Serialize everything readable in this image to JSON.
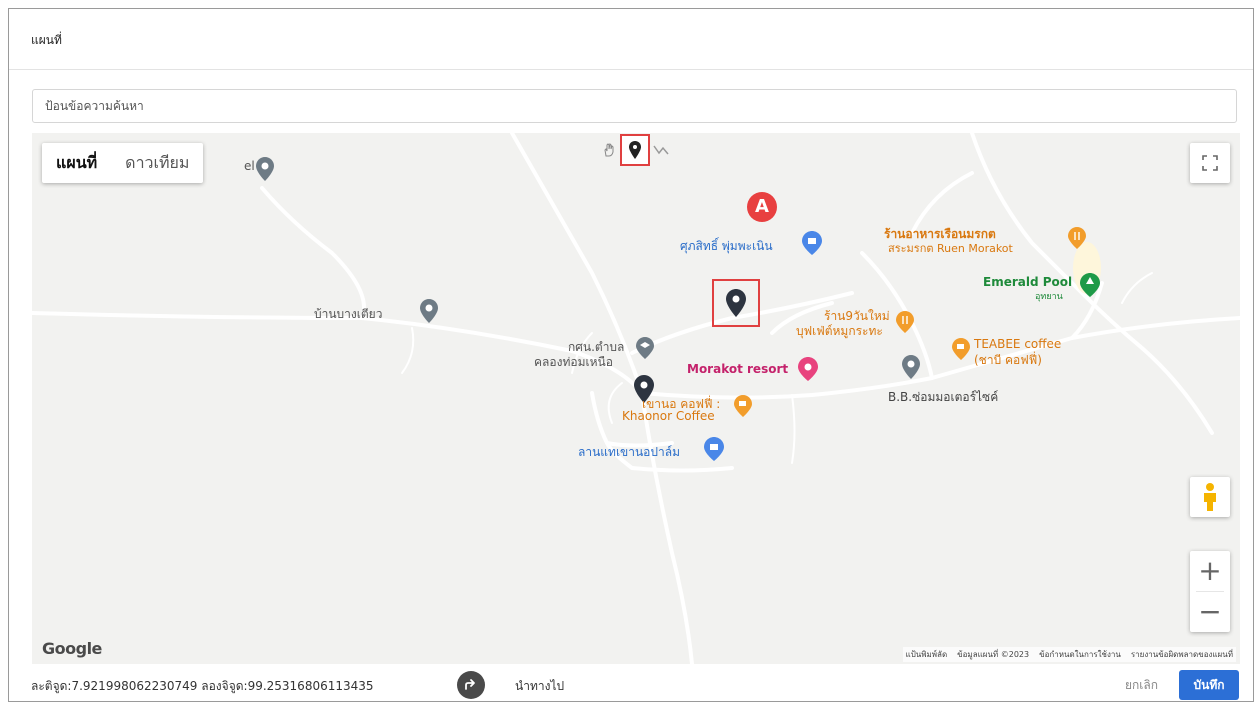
{
  "dialog": {
    "title": "แผนที่"
  },
  "search": {
    "placeholder": "ป้อนข้อความค้นหา"
  },
  "map": {
    "type_controls": {
      "map": "แผนที่",
      "satellite": "ดาวเทียม"
    },
    "badge": "A",
    "google": "Google",
    "attribution": [
      "แป้นพิมพ์ลัด",
      "ข้อมูลแผนที่ ©2023",
      "ข้อกำหนดในการใช้งาน",
      "รายงานข้อผิดพลาดของแผนที่"
    ],
    "labels": {
      "el": "el",
      "sukasit": "ศุภสิทธิ์ พุ่มพะเนิน",
      "ruen_th": "ร้านอาหารเรือนมรกต",
      "ruen_en": "สระมรกต Ruen Morakot",
      "emerald": "Emerald Pool",
      "emerald_sub": "อุทยาน",
      "ban_bang": "บ้านบางเตียว",
      "r9_1": "ร้าน9วันใหม่",
      "r9_2": "บุฟเฟ่ต์หมูกระทะ",
      "teabee_1": "TEABEE coffee",
      "teabee_2": "(ชาบี คอฟฟี่)",
      "kosn_1": "กศน.ตำบล",
      "kosn_2": "คลองท่อมเหนือ",
      "morakot": "Morakot resort",
      "bb": "B.B.ซ่อมมอเตอร์ไซค์",
      "khaonor_1": "เขานอ คอฟฟี่ :",
      "khaonor_2": "Khaonor Coffee",
      "lan": "ลานแทเขานอปาล์ม"
    },
    "icons": [
      "hand-icon",
      "marker-icon",
      "polyline-icon",
      "fullscreen-icon",
      "pegman-icon",
      "zoom-in-icon",
      "zoom-out-icon"
    ]
  },
  "footer": {
    "coords": "ละติจูด:7.921998062230749  ลองจิจูด:99.25316806113435",
    "navigate": "นำทางไป",
    "cancel": "ยกเลิก",
    "save": "บันทึก"
  },
  "colors": {
    "primary": "#2c6fd6",
    "highlight": "#e04040"
  }
}
